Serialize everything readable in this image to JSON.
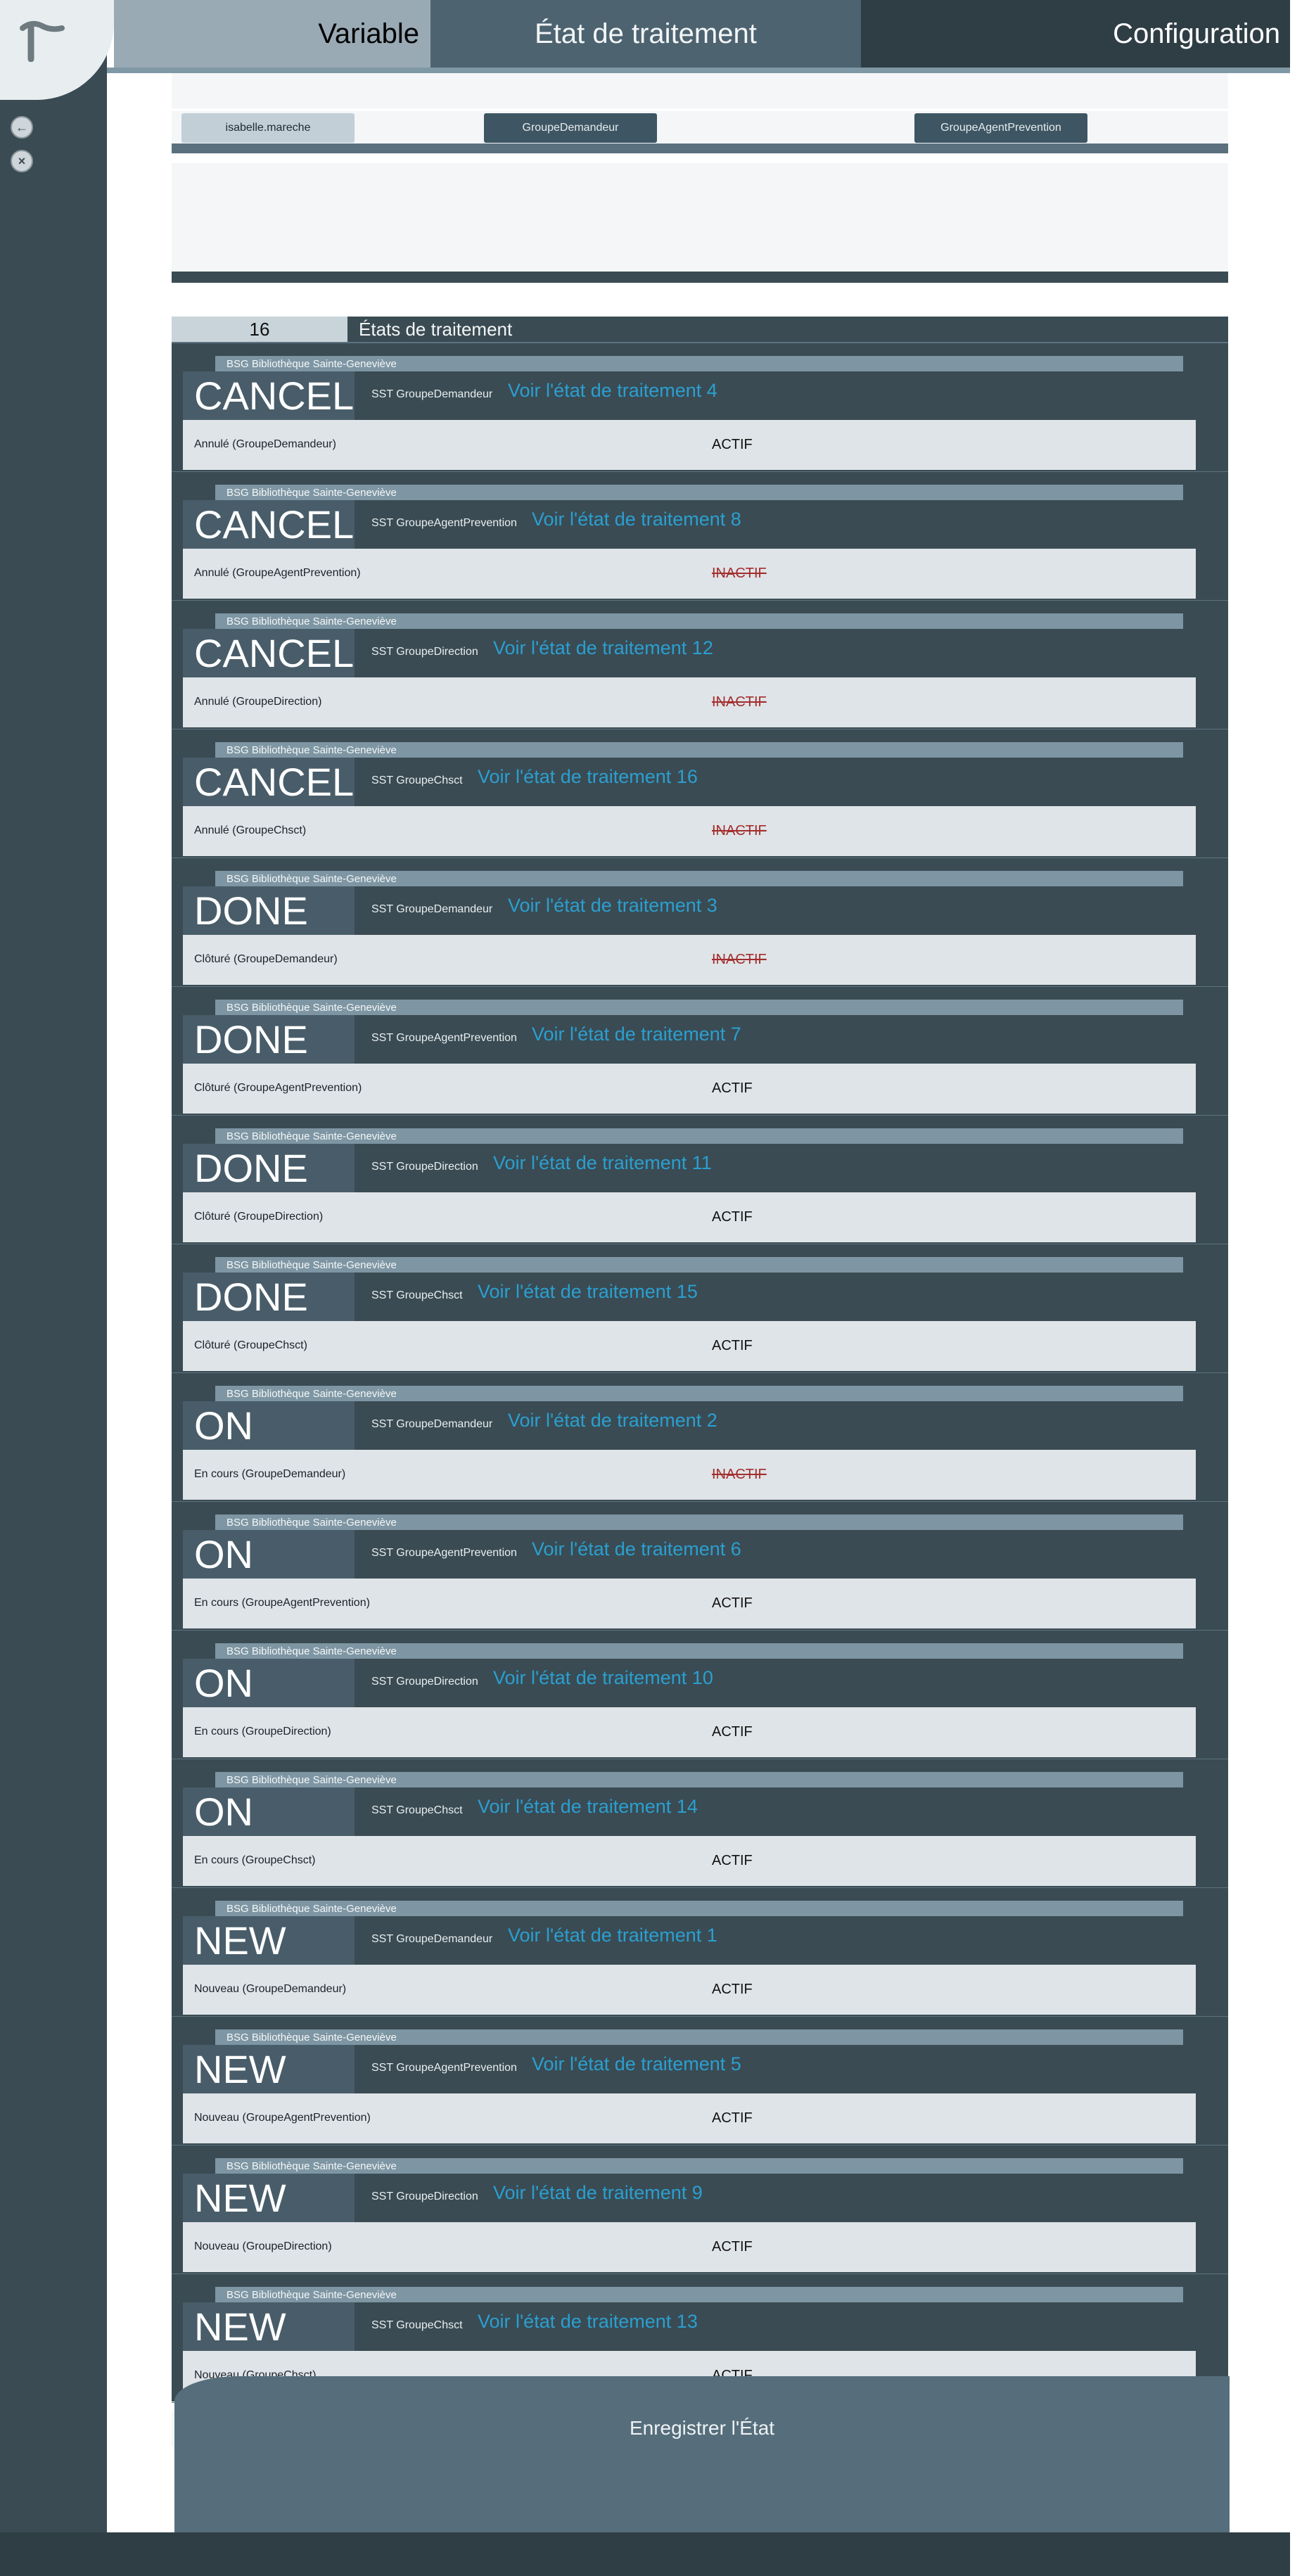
{
  "tabs": {
    "variable": "Variable",
    "etat": "État de traitement",
    "configuration": "Configuration"
  },
  "user": {
    "name": "isabelle.mareche"
  },
  "groups": [
    "GroupeDemandeur",
    "GroupeAgentPrevention"
  ],
  "list": {
    "count": "16",
    "title": "États de traitement"
  },
  "items": [
    {
      "org": "BSG Bibliothèque Sainte-Geneviève",
      "code": "CANCEL",
      "group": "SST GroupeDemandeur",
      "link": "Voir l'état de traitement 4",
      "label": "Annulé (GroupeDemandeur)",
      "status": "ACTIF"
    },
    {
      "org": "BSG Bibliothèque Sainte-Geneviève",
      "code": "CANCEL",
      "group": "SST GroupeAgentPrevention",
      "link": "Voir l'état de traitement 8",
      "label": "Annulé (GroupeAgentPrevention)",
      "status": "INACTIF"
    },
    {
      "org": "BSG Bibliothèque Sainte-Geneviève",
      "code": "CANCEL",
      "group": "SST GroupeDirection",
      "link": "Voir l'état de traitement 12",
      "label": "Annulé (GroupeDirection)",
      "status": "INACTIF"
    },
    {
      "org": "BSG Bibliothèque Sainte-Geneviève",
      "code": "CANCEL",
      "group": "SST GroupeChsct",
      "link": "Voir l'état de traitement 16",
      "label": "Annulé (GroupeChsct)",
      "status": "INACTIF"
    },
    {
      "org": "BSG Bibliothèque Sainte-Geneviève",
      "code": "DONE",
      "group": "SST GroupeDemandeur",
      "link": "Voir l'état de traitement 3",
      "label": "Clôturé (GroupeDemandeur)",
      "status": "INACTIF"
    },
    {
      "org": "BSG Bibliothèque Sainte-Geneviève",
      "code": "DONE",
      "group": "SST GroupeAgentPrevention",
      "link": "Voir l'état de traitement 7",
      "label": "Clôturé (GroupeAgentPrevention)",
      "status": "ACTIF"
    },
    {
      "org": "BSG Bibliothèque Sainte-Geneviève",
      "code": "DONE",
      "group": "SST GroupeDirection",
      "link": "Voir l'état de traitement 11",
      "label": "Clôturé (GroupeDirection)",
      "status": "ACTIF"
    },
    {
      "org": "BSG Bibliothèque Sainte-Geneviève",
      "code": "DONE",
      "group": "SST GroupeChsct",
      "link": "Voir l'état de traitement 15",
      "label": "Clôturé (GroupeChsct)",
      "status": "ACTIF"
    },
    {
      "org": "BSG Bibliothèque Sainte-Geneviève",
      "code": "ON",
      "group": "SST GroupeDemandeur",
      "link": "Voir l'état de traitement 2",
      "label": "En cours (GroupeDemandeur)",
      "status": "INACTIF"
    },
    {
      "org": "BSG Bibliothèque Sainte-Geneviève",
      "code": "ON",
      "group": "SST GroupeAgentPrevention",
      "link": "Voir l'état de traitement 6",
      "label": "En cours (GroupeAgentPrevention)",
      "status": "ACTIF"
    },
    {
      "org": "BSG Bibliothèque Sainte-Geneviève",
      "code": "ON",
      "group": "SST GroupeDirection",
      "link": "Voir l'état de traitement 10",
      "label": "En cours (GroupeDirection)",
      "status": "ACTIF"
    },
    {
      "org": "BSG Bibliothèque Sainte-Geneviève",
      "code": "ON",
      "group": "SST GroupeChsct",
      "link": "Voir l'état de traitement 14",
      "label": "En cours (GroupeChsct)",
      "status": "ACTIF"
    },
    {
      "org": "BSG Bibliothèque Sainte-Geneviève",
      "code": "NEW",
      "group": "SST GroupeDemandeur",
      "link": "Voir l'état de traitement 1",
      "label": "Nouveau (GroupeDemandeur)",
      "status": "ACTIF"
    },
    {
      "org": "BSG Bibliothèque Sainte-Geneviève",
      "code": "NEW",
      "group": "SST GroupeAgentPrevention",
      "link": "Voir l'état de traitement 5",
      "label": "Nouveau (GroupeAgentPrevention)",
      "status": "ACTIF"
    },
    {
      "org": "BSG Bibliothèque Sainte-Geneviève",
      "code": "NEW",
      "group": "SST GroupeDirection",
      "link": "Voir l'état de traitement 9",
      "label": "Nouveau (GroupeDirection)",
      "status": "ACTIF"
    },
    {
      "org": "BSG Bibliothèque Sainte-Geneviève",
      "code": "NEW",
      "group": "SST GroupeChsct",
      "link": "Voir l'état de traitement 13",
      "label": "Nouveau (GroupeChsct)",
      "status": "ACTIF"
    }
  ],
  "save_button": "Enregistrer l'État",
  "icons": {
    "back": "back-icon",
    "close": "close-icon",
    "logo": "logo-icon"
  },
  "colors": {
    "sidebar": "#3a4b53",
    "accent": "#566e7b",
    "link": "#2b9fd0",
    "inactive": "#a32e2e"
  }
}
